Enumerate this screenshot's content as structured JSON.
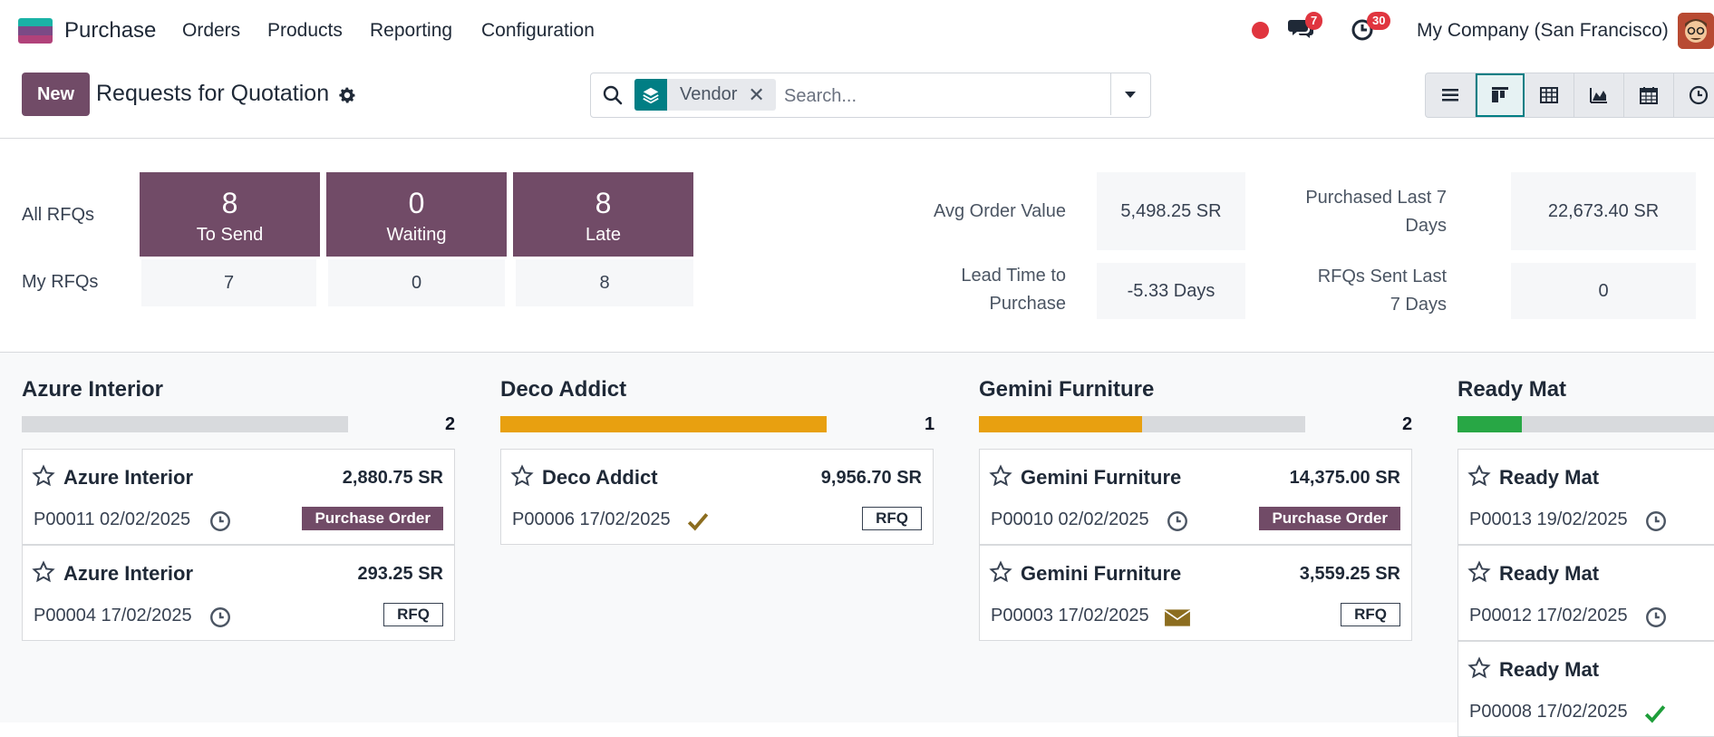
{
  "navbar": {
    "app_name": "Purchase",
    "menus": [
      "Orders",
      "Products",
      "Reporting",
      "Configuration"
    ],
    "messages_count": "7",
    "activities_count": "30",
    "company": "My Company (San Francisco)"
  },
  "control": {
    "new_label": "New",
    "title": "Requests for Quotation",
    "facet_label": "Vendor",
    "search_placeholder": "Search..."
  },
  "dashboard": {
    "all_rfqs_label": "All RFQs",
    "my_rfqs_label": "My RFQs",
    "tiles": [
      {
        "count": "8",
        "label": "To Send"
      },
      {
        "count": "0",
        "label": "Waiting"
      },
      {
        "count": "8",
        "label": "Late"
      }
    ],
    "my_values": [
      "7",
      "0",
      "8"
    ],
    "stats": {
      "avg_order_label": "Avg Order Value",
      "avg_order_value": "5,498.25 SR",
      "lead_time_label": "Lead Time to Purchase",
      "lead_time_value": "-5.33 Days",
      "purchased_label": "Purchased Last 7 Days",
      "purchased_value": "22,673.40 SR",
      "sent_label": "RFQs Sent Last 7 Days",
      "sent_value": "0"
    }
  },
  "kanban": {
    "columns": [
      {
        "title": "Azure Interior",
        "count": "2",
        "progress": {
          "green": 0,
          "orange": 0
        },
        "cards": [
          {
            "name": "Azure Interior",
            "amount": "2,880.75 SR",
            "ref": "P00011 02/02/2025",
            "activity": "clock-icon",
            "tag": "Purchase Order",
            "tag_type": "po"
          },
          {
            "name": "Azure Interior",
            "amount": "293.25 SR",
            "ref": "P00004 17/02/2025",
            "activity": "clock-icon",
            "tag": "RFQ",
            "tag_type": "rfq"
          }
        ]
      },
      {
        "title": "Deco Addict",
        "count": "1",
        "progress": {
          "green": 0,
          "orange": 1.0
        },
        "cards": [
          {
            "name": "Deco Addict",
            "amount": "9,956.70 SR",
            "ref": "P00006 17/02/2025",
            "activity": "check-icon",
            "tag": "RFQ",
            "tag_type": "rfq"
          }
        ]
      },
      {
        "title": "Gemini Furniture",
        "count": "2",
        "progress": {
          "green": 0,
          "orange": 0.5
        },
        "cards": [
          {
            "name": "Gemini Furniture",
            "amount": "14,375.00 SR",
            "ref": "P00010 02/02/2025",
            "activity": "clock-icon",
            "tag": "Purchase Order",
            "tag_type": "po"
          },
          {
            "name": "Gemini Furniture",
            "amount": "3,559.25 SR",
            "ref": "P00003 17/02/2025",
            "activity": "envelope-icon",
            "tag": "RFQ",
            "tag_type": "rfq"
          }
        ]
      },
      {
        "title": "Ready Mat",
        "count": "",
        "progress": {
          "green": 0.25,
          "orange": 0
        },
        "cards": [
          {
            "name": "Ready Mat",
            "amount": "",
            "ref": "P00013 19/02/2025",
            "activity": "clock-icon",
            "tag": "",
            "tag_type": ""
          },
          {
            "name": "Ready Mat",
            "amount": "",
            "ref": "P00012 17/02/2025",
            "activity": "clock-icon",
            "tag": "",
            "tag_type": ""
          },
          {
            "name": "Ready Mat",
            "amount": "",
            "ref": "P00008 17/02/2025",
            "activity": "check-green-icon",
            "tag": "",
            "tag_type": ""
          }
        ]
      }
    ]
  },
  "colors": {
    "primary": "#714B67",
    "teal": "#017e84",
    "progress_orange": "#e8a010",
    "progress_green": "#28a745",
    "badge_red": "#e0353f"
  }
}
